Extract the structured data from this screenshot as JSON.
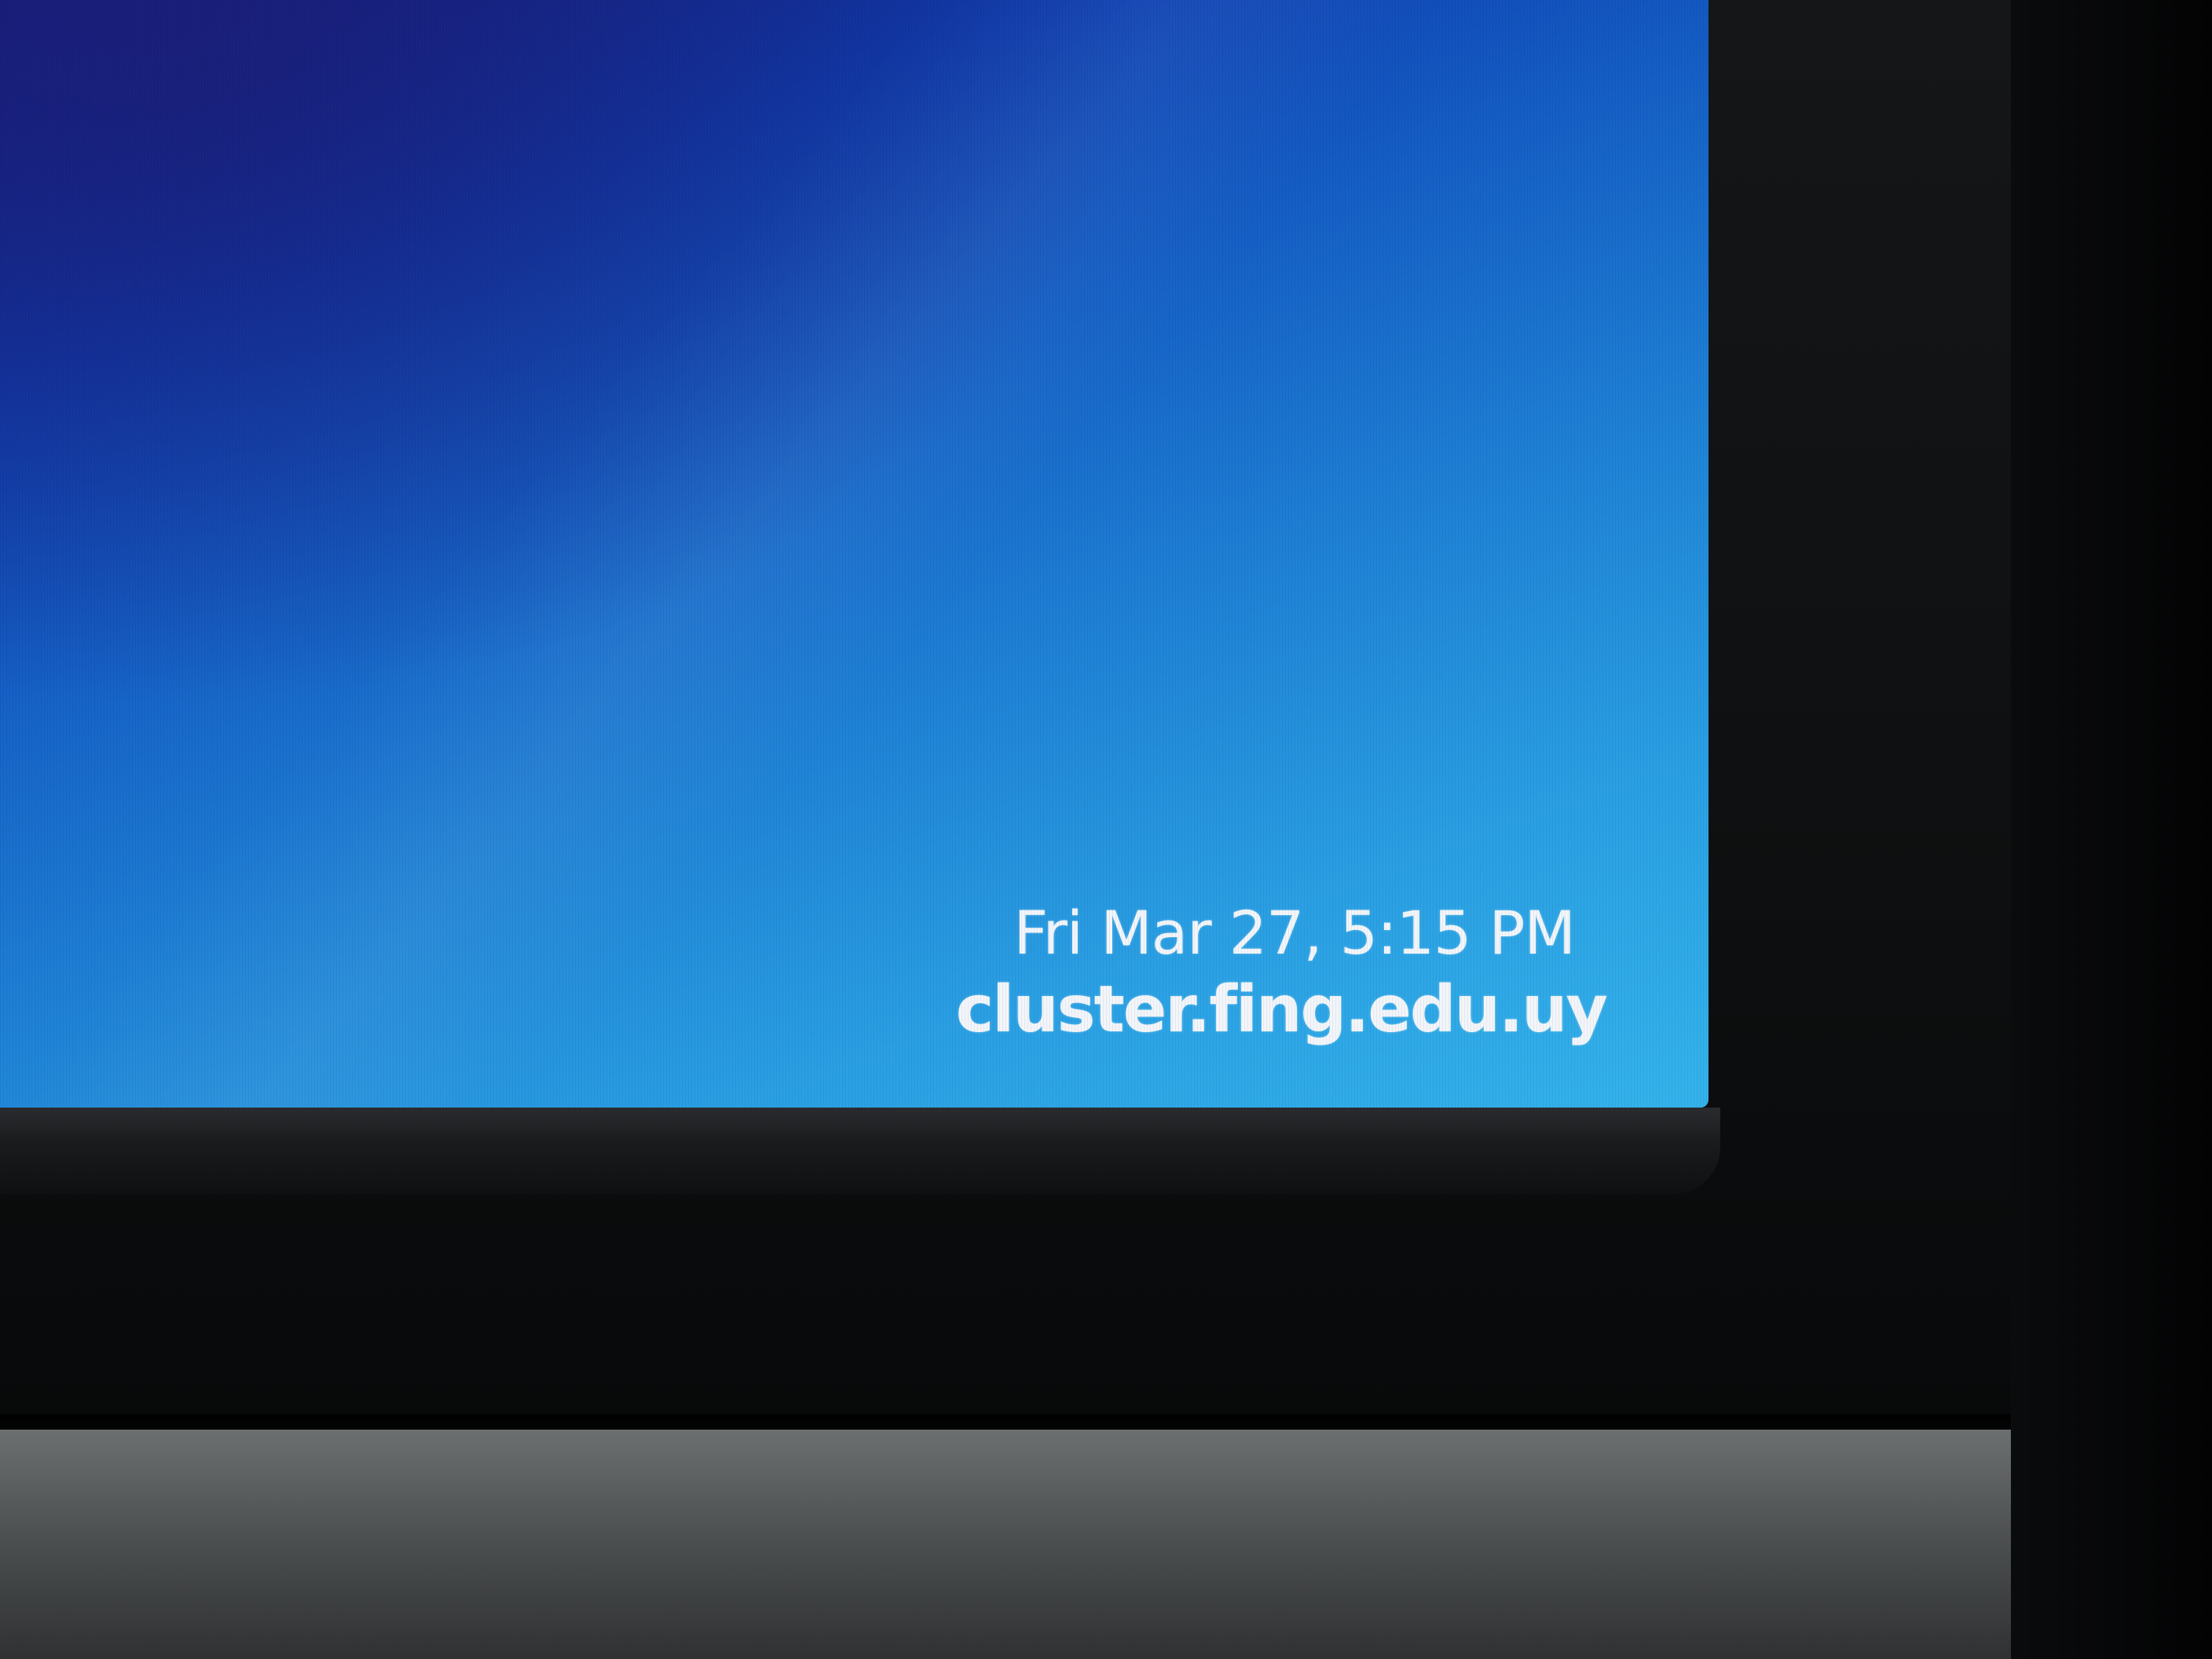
{
  "desktop": {
    "clock_text": "Fri Mar 27,  5:15 PM",
    "hostname_text": "cluster.fing.edu.uy"
  },
  "colors": {
    "wallpaper_top": "#131a7c",
    "wallpaper_bottom": "#34b3ec",
    "text": "#f2f6fb",
    "bezel": "#111314",
    "desk": "#5a5d5e"
  }
}
